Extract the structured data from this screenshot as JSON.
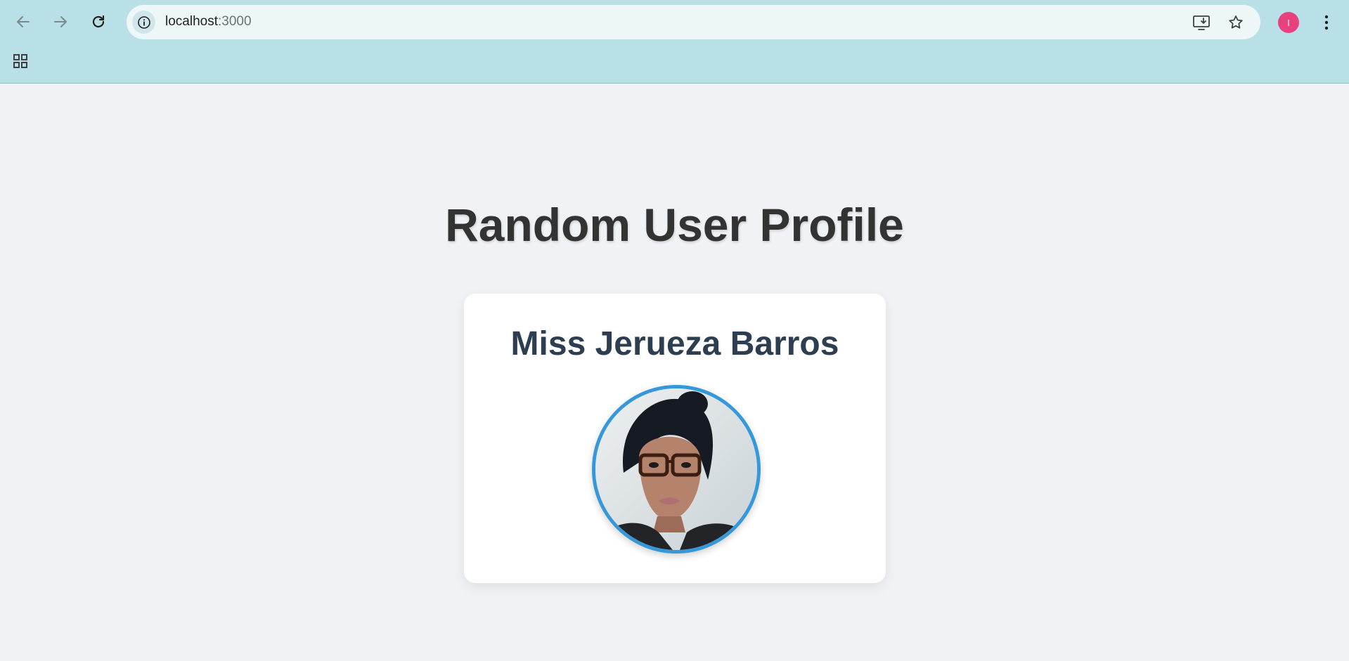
{
  "browser": {
    "url_host": "localhost",
    "url_port": ":3000",
    "profile_initial": "I",
    "icons": {
      "back": "arrow-left-icon",
      "forward": "arrow-right-icon",
      "reload": "reload-icon",
      "site_info": "info-icon",
      "install": "install-app-icon",
      "bookmark": "star-icon",
      "menu": "kebab-menu-icon",
      "apps": "apps-grid-icon"
    },
    "colors": {
      "chrome_bg": "#b8e0e6",
      "omnibox_bg": "#eef7f8",
      "avatar_bg": "#e8417e"
    }
  },
  "page": {
    "title": "Random User Profile",
    "background": "#f0f2f5"
  },
  "profile": {
    "name": "Miss Jerueza Barros",
    "photo_alt": "User",
    "accent": "#3498db"
  }
}
